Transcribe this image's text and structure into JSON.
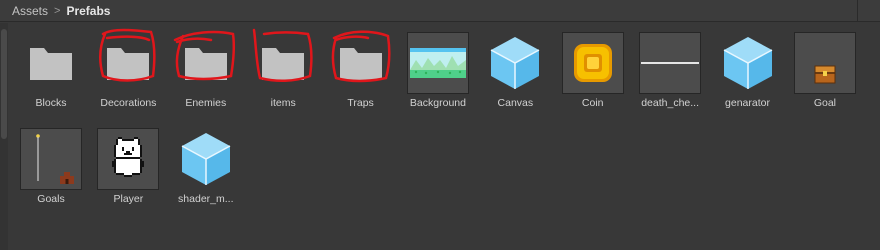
{
  "breadcrumb": {
    "items": [
      "Assets",
      "Prefabs"
    ],
    "separator": ">"
  },
  "assets": [
    {
      "label": "Blocks",
      "type": "folder",
      "icon": "folder-icon"
    },
    {
      "label": "Decorations",
      "type": "folder",
      "icon": "folder-icon",
      "circled": true
    },
    {
      "label": "Enemies",
      "type": "folder",
      "icon": "folder-icon",
      "circled": true
    },
    {
      "label": "items",
      "type": "folder",
      "icon": "folder-icon",
      "circled": true
    },
    {
      "label": "Traps",
      "type": "folder",
      "icon": "folder-icon",
      "circled": true
    },
    {
      "label": "Background",
      "type": "prefab",
      "icon": "background-thumbnail-icon"
    },
    {
      "label": "Canvas",
      "type": "prefab",
      "icon": "cube-icon"
    },
    {
      "label": "Coin",
      "type": "prefab",
      "icon": "coin-icon"
    },
    {
      "label": "death_che...",
      "type": "prefab",
      "icon": "line-icon"
    },
    {
      "label": "genarator",
      "type": "prefab",
      "icon": "cube-icon"
    },
    {
      "label": "Goal",
      "type": "prefab",
      "icon": "chest-icon"
    },
    {
      "label": "Goals",
      "type": "prefab",
      "icon": "flagpole-icon"
    },
    {
      "label": "Player",
      "type": "prefab",
      "icon": "cat-icon"
    },
    {
      "label": "shader_m...",
      "type": "prefab",
      "icon": "cube-icon"
    }
  ],
  "colors": {
    "background": "#383838",
    "cube": "#7fcff5",
    "coin": "#f7b500",
    "annotation": "#e0161b"
  }
}
